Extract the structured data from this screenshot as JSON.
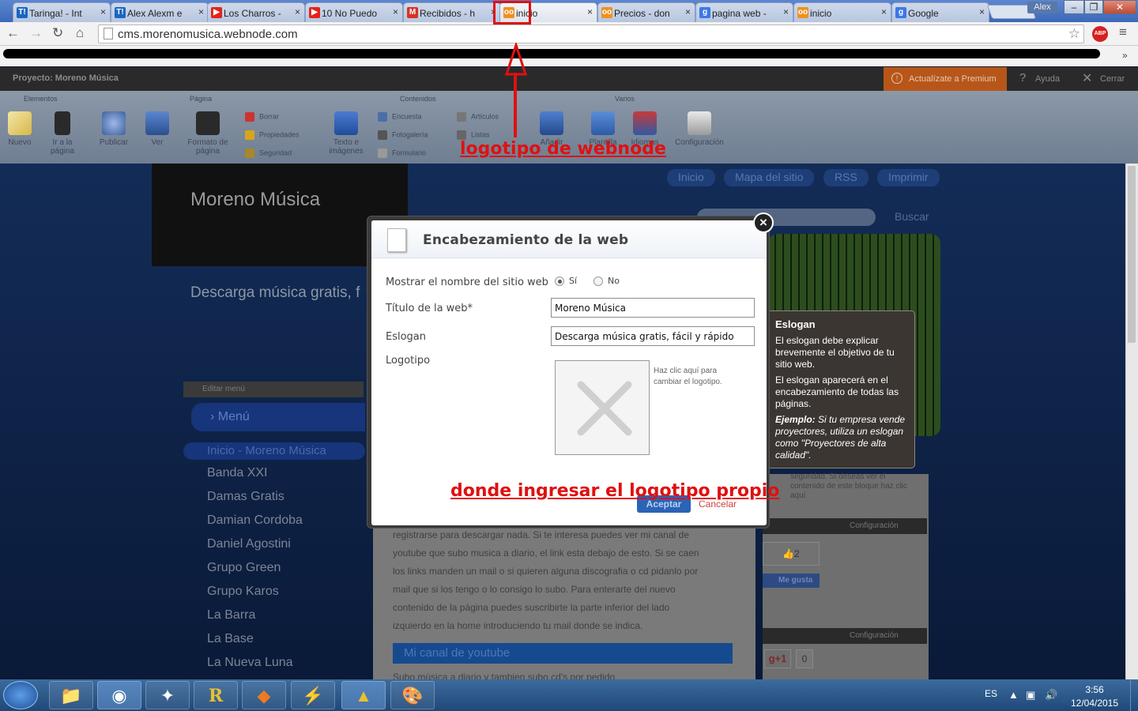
{
  "browser": {
    "tabs": [
      {
        "label": "Taringa! - Int",
        "icon": "taringa-icon",
        "icon_text": "T!",
        "color": "#1a66c2"
      },
      {
        "label": "Alex Alexm e",
        "icon": "taringa-icon",
        "icon_text": "T!",
        "color": "#1a66c2"
      },
      {
        "label": "Los Charros -",
        "icon": "youtube-icon",
        "icon_text": "▶",
        "color": "#e62117"
      },
      {
        "label": "10 No Puedo",
        "icon": "youtube-icon",
        "icon_text": "▶",
        "color": "#e62117"
      },
      {
        "label": "Recibidos - h",
        "icon": "gmail-icon",
        "icon_text": "M",
        "color": "#d93025"
      },
      {
        "label": "inicio",
        "icon": "webnode-icon",
        "icon_text": "oo",
        "color": "#f09020"
      },
      {
        "label": "Precios - don",
        "icon": "webnode-icon",
        "icon_text": "oo",
        "color": "#f09020"
      },
      {
        "label": "pagina web -",
        "icon": "google-icon",
        "icon_text": "g",
        "color": "#3b78e7"
      },
      {
        "label": "inicio",
        "icon": "webnode-icon",
        "icon_text": "oo",
        "color": "#f09020"
      },
      {
        "label": "Google",
        "icon": "google-icon",
        "icon_text": "g",
        "color": "#3b78e7"
      }
    ],
    "close_glyph": "×",
    "user": "Alex",
    "url": "cms.morenomusica.webnode.com",
    "abp": "ABP",
    "more": "»"
  },
  "admin": {
    "project": "Proyecto: Moreno Música",
    "premium": "Actualízate a Premium",
    "help": "Ayuda",
    "close": "Cerrar",
    "groups": [
      "Elementos",
      "Página",
      "Contenidos",
      "Varios"
    ],
    "buttons": {
      "nuevo": "Nuevo",
      "ir": "Ir a la página",
      "publicar": "Publicar",
      "ver": "Ver",
      "formato": "Formato de página",
      "texto": "Texto e imágenes",
      "agregar": "Añadir",
      "plantilla": "Plantilla",
      "idiomas": "Idiomas",
      "config": "Configuración"
    },
    "small": {
      "borrar": "Borrar",
      "propiedades": "Propiedades",
      "seguridad": "Seguridad",
      "encuesta": "Encuesta",
      "fotogaleria": "Fotogalería",
      "formulario": "Formulario",
      "articulos": "Artículos",
      "listas": "Listas"
    }
  },
  "site": {
    "name": "Moreno Música",
    "slogan": "Descarga música gratis, f",
    "nav": [
      "Inicio",
      "Mapa del sitio",
      "RSS",
      "Imprimir"
    ],
    "search_button": "Buscar",
    "edit_menu": "Editar menú",
    "menu_title": "Menú",
    "menu_active": "Inicio - Moreno Música",
    "menu": [
      "Banda XXI",
      "Damas Gratis",
      "Damian Cordoba",
      "Daniel Agostini",
      "Grupo Green",
      "Grupo Karos",
      "La Barra",
      "La Base",
      "La Nueva Luna"
    ],
    "content_lines": [
      "registrarse para descargar nada. Si te interesa puedes ver mi canal de",
      "youtube que subo musica a diario, el link esta debajo de esto. Si se caen",
      "los links manden un mail o si quieren alguna discografia o cd pidanlo por",
      "mail que si los tengo o lo consigo lo subo. Para enterarte del nuevo",
      "contenido de la página puedes suscribirte la parte inferior del lado",
      "izquierdo en la home introduciendo tu mail donde se indica."
    ],
    "youtube_heading": "Mi canal de youtube",
    "sub_text": "Subo música a diario y tambien subo cd's por pedido.",
    "right_text": "seguridad. Si deseas ver el contenido de este bloque haz clic aquí",
    "config": "Configuración",
    "likes": "2",
    "like_btn": "Me gusta",
    "gplus": "g+1",
    "gplus_count": "0"
  },
  "dialog": {
    "title": "Encabezamiento de la web",
    "show_name_label": "Mostrar el nombre del sitio web",
    "yes": "Sí",
    "no": "No",
    "title_label": "Título de la web*",
    "title_value": "Moreno Música",
    "slogan_label": "Eslogan",
    "slogan_value": "Descarga música gratis, fácil y rápido",
    "logo_label": "Logotipo",
    "logo_hint": "Haz clic aquí para cambiar el logotipo.",
    "accept": "Aceptar",
    "cancel": "Cancelar",
    "close": "×"
  },
  "tooltip": {
    "title": "Eslogan",
    "p1": "El eslogan debe explicar brevemente el objetivo de tu sitio web.",
    "p2": "El eslogan aparecerá en el encabezamiento de todas las páginas.",
    "p3_bold": "Ejemplo:",
    "p3": " Si tu empresa vende proyectores, utiliza un eslogan como \"Proyectores de alta calidad\"."
  },
  "annotations": {
    "top": "logotipo de webnode",
    "bottom": "donde ingresar el logotipo propio",
    "color": "#e01010"
  },
  "taskbar": {
    "lang": "ES",
    "time": "3:56",
    "date": "12/04/2015"
  }
}
